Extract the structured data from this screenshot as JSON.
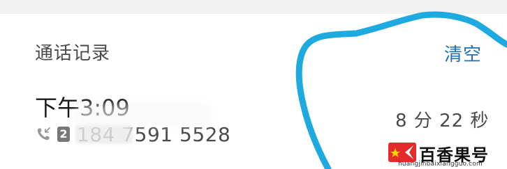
{
  "section": {
    "title": "通话记录",
    "clear_label": "清空"
  },
  "call": {
    "time": "下午3:09",
    "sim": "2",
    "number": "184 7591 5528",
    "duration": "8 分 22 秒",
    "call_icon": "incoming-call-icon"
  },
  "watermark": {
    "name": "百香果号",
    "url": "huangjinbaixiangguo.com"
  },
  "colors": {
    "accent": "#1e6fb3",
    "annotation": "#1fa9e1",
    "text": "#4a4a4a"
  }
}
